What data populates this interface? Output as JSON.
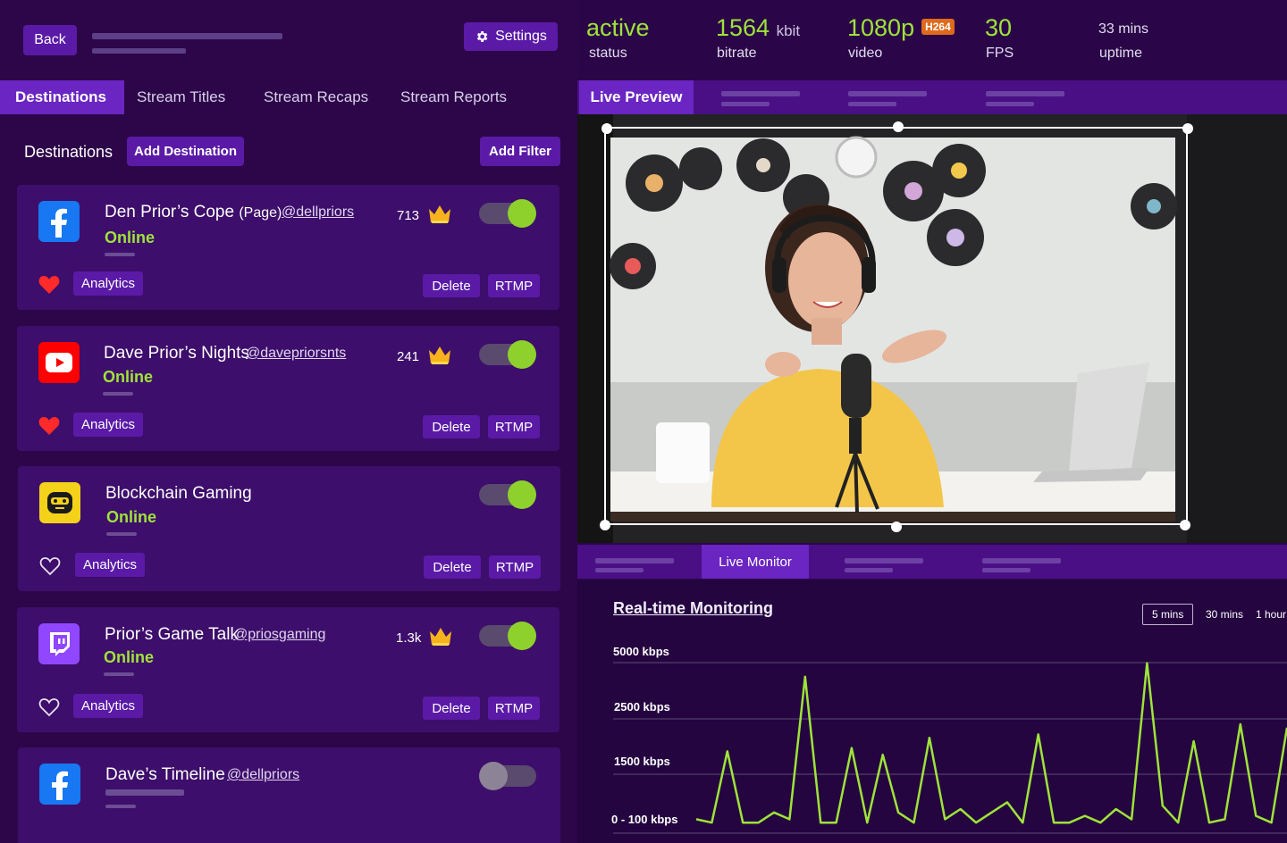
{
  "header": {
    "back_label": "Back",
    "settings_label": "Settings",
    "settings_icon": "gear-icon"
  },
  "left_tabs": [
    "Destinations",
    "Stream Titles",
    "Stream Recaps",
    "Stream Reports"
  ],
  "destinations_bar": {
    "label": "Destinations",
    "add_destination": "Add Destination",
    "add_filter": "Add Filter"
  },
  "cards": [
    {
      "platform": "facebook",
      "name": "Den Prior’s Cope",
      "name_suffix": "(Page)",
      "handle": "@dellpriors",
      "status": "Online",
      "count": "713",
      "enabled": true,
      "favorite": true,
      "analytics": "Analytics",
      "delete": "Delete",
      "rtmp": "RTMP"
    },
    {
      "platform": "youtube",
      "name": "Dave Prior’s Nights",
      "name_suffix": "",
      "handle": "@davepriorsnts",
      "status": "Online",
      "count": "241",
      "enabled": true,
      "favorite": true,
      "analytics": "Analytics",
      "delete": "Delete",
      "rtmp": "RTMP"
    },
    {
      "platform": "blockchain-gaming",
      "name": "Blockchain Gaming",
      "name_suffix": "",
      "handle": "",
      "status": "Online",
      "count": "",
      "enabled": true,
      "favorite": false,
      "analytics": "Analytics",
      "delete": "Delete",
      "rtmp": "RTMP"
    },
    {
      "platform": "twitch",
      "name": "Prior’s Game Talk",
      "name_suffix": "",
      "handle": "@priosgaming",
      "status": "Online",
      "count": "1.3k",
      "enabled": true,
      "favorite": false,
      "analytics": "Analytics",
      "delete": "Delete",
      "rtmp": "RTMP"
    },
    {
      "platform": "facebook",
      "name": "Dave’s Timeline",
      "name_suffix": "",
      "handle": "@dellpriors",
      "status": "",
      "count": "",
      "enabled": false,
      "favorite": false,
      "analytics": "Analytics",
      "delete": "Delete",
      "rtmp": "RTMP"
    }
  ],
  "metrics": [
    {
      "value": "active",
      "unit": "",
      "label": "status"
    },
    {
      "value": "1564",
      "unit": "kbit",
      "label": "bitrate"
    },
    {
      "value": "1080p",
      "unit": "",
      "badge": "H264",
      "label": "video"
    },
    {
      "value": "30",
      "unit": "",
      "label": "FPS"
    },
    {
      "value": "33 mins",
      "unit": "",
      "label": "uptime"
    }
  ],
  "preview": {
    "tab_label": "Live Preview"
  },
  "monitor": {
    "tab_label": "Live Monitor",
    "title": "Real-time Monitoring",
    "ranges": [
      "5 mins",
      "30 mins",
      "1 hour"
    ],
    "selected_range": "5 mins"
  },
  "chart_data": {
    "type": "line",
    "title": "Real-time Monitoring",
    "y_tick_labels": [
      "5000 kbps",
      "2500 kbps",
      "1500 kbps",
      "0 - 100 kbps"
    ],
    "series": [
      {
        "color": "#9fe33a",
        "values": [
          2,
          1,
          22,
          1,
          1,
          4,
          2,
          44,
          1,
          1,
          23,
          1,
          21,
          4,
          1,
          26,
          2,
          5,
          1,
          4,
          7,
          1,
          27,
          1,
          1,
          3,
          1,
          5,
          2,
          48,
          6,
          1,
          25,
          1,
          2,
          30,
          3,
          1,
          29
        ]
      }
    ],
    "line_color": "#9fe33a"
  }
}
